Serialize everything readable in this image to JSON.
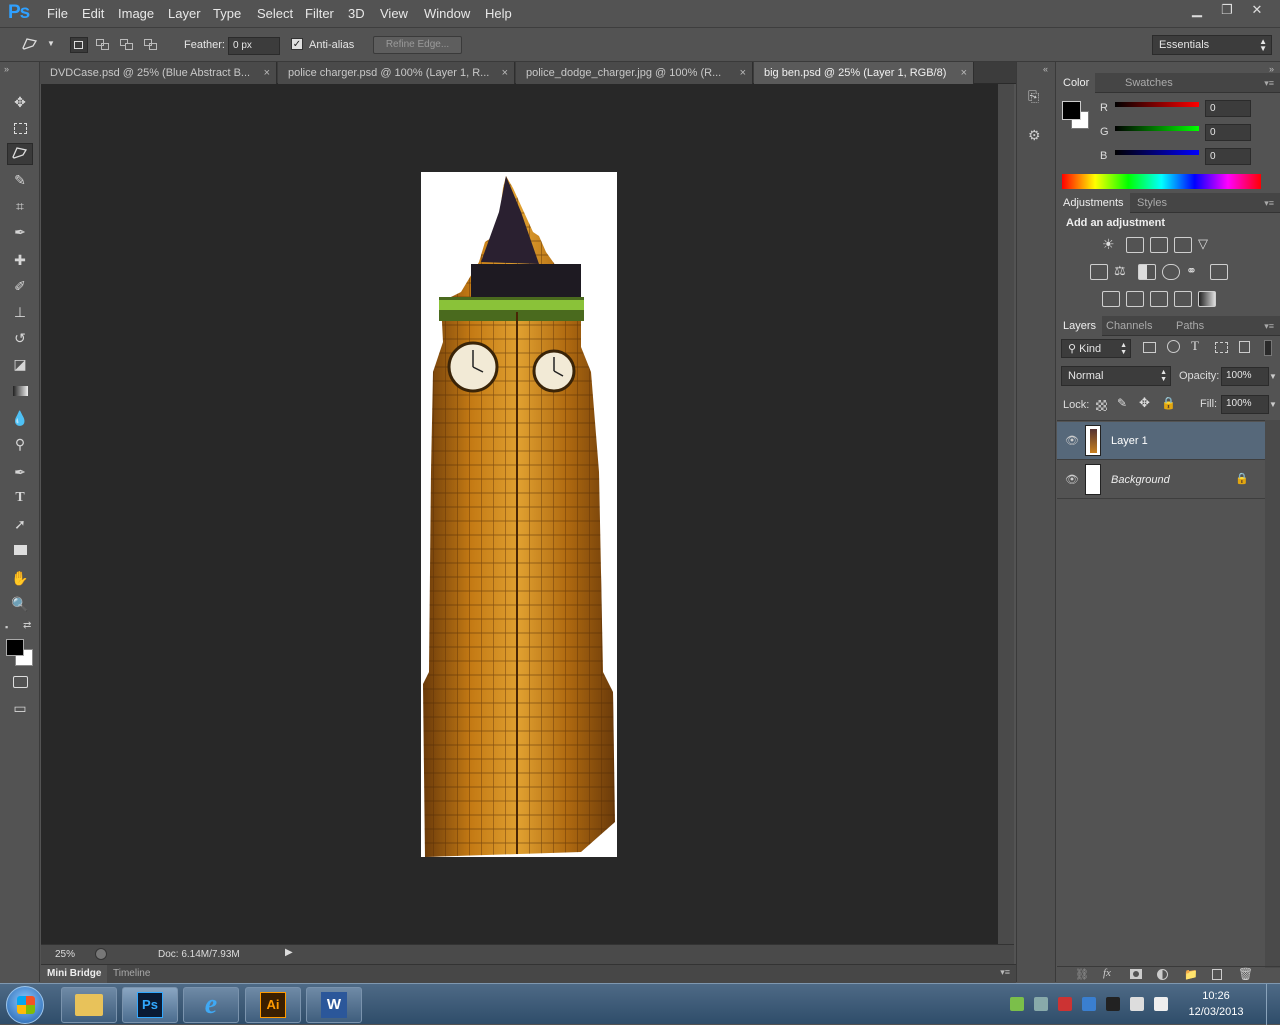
{
  "app": {
    "logo": "Ps"
  },
  "menu": [
    "File",
    "Edit",
    "Image",
    "Layer",
    "Type",
    "Select",
    "Filter",
    "3D",
    "View",
    "Window",
    "Help"
  ],
  "options": {
    "feather_label": "Feather:",
    "feather_value": "0 px",
    "antialias_label": "Anti-alias",
    "antialias_checked": true,
    "refine_edge": "Refine Edge...",
    "workspace": "Essentials"
  },
  "tabs": [
    {
      "label": "DVDCase.psd @ 25% (Blue Abstract B...",
      "active": false
    },
    {
      "label": "police charger.psd @ 100% (Layer 1, R...",
      "active": false
    },
    {
      "label": "police_dodge_charger.jpg @ 100% (R...",
      "active": false
    },
    {
      "label": "big ben.psd @ 25% (Layer 1, RGB/8)",
      "active": true
    }
  ],
  "tools": [
    "move-tool",
    "marquee-tool",
    "polygonal-lasso-tool",
    "quick-selection-tool",
    "crop-tool",
    "eyedropper-tool",
    "healing-brush-tool",
    "brush-tool",
    "clone-stamp-tool",
    "history-brush-tool",
    "eraser-tool",
    "gradient-tool",
    "blur-tool",
    "dodge-tool",
    "pen-tool",
    "type-tool",
    "path-selection-tool",
    "rectangle-tool",
    "hand-tool",
    "zoom-tool"
  ],
  "status": {
    "zoom": "25%",
    "doc": "Doc: 6.14M/7.93M"
  },
  "bottom_tabs": [
    "Mini Bridge",
    "Timeline"
  ],
  "color_panel": {
    "tabs": [
      "Color",
      "Swatches"
    ],
    "channels": [
      {
        "name": "R",
        "value": "0"
      },
      {
        "name": "G",
        "value": "0"
      },
      {
        "name": "B",
        "value": "0"
      }
    ]
  },
  "adjustments_panel": {
    "tabs": [
      "Adjustments",
      "Styles"
    ],
    "title": "Add an adjustment"
  },
  "layers_panel": {
    "tabs": [
      "Layers",
      "Channels",
      "Paths"
    ],
    "filter": "Kind",
    "blend_mode": "Normal",
    "opacity_label": "Opacity:",
    "opacity": "100%",
    "lock_label": "Lock:",
    "fill_label": "Fill:",
    "fill": "100%",
    "layers": [
      {
        "name": "Layer 1",
        "selected": true
      },
      {
        "name": "Background",
        "selected": false,
        "locked": true
      }
    ]
  },
  "taskbar": {
    "apps": [
      "explorer",
      "photoshop",
      "internet-explorer",
      "illustrator",
      "word"
    ],
    "time": "10:26",
    "date": "12/03/2013"
  },
  "colors": {
    "accent": "#2fa0ff",
    "canvas": "#282828",
    "selected_layer": "#56687a"
  }
}
